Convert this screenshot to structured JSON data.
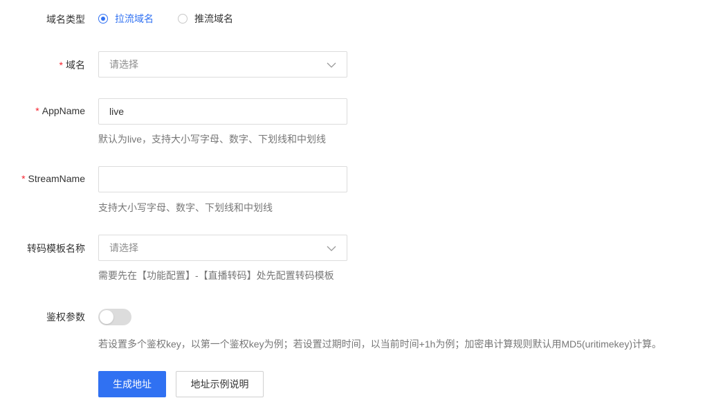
{
  "form": {
    "domain_type": {
      "label": "域名类型",
      "options": [
        {
          "label": "拉流域名",
          "checked": true
        },
        {
          "label": "推流域名",
          "checked": false
        }
      ]
    },
    "domain": {
      "required_mark": "*",
      "label": "域名",
      "placeholder": "请选择"
    },
    "app_name": {
      "required_mark": "*",
      "label": "AppName",
      "value": "live",
      "help": "默认为live，支持大小写字母、数字、下划线和中划线"
    },
    "stream_name": {
      "required_mark": "*",
      "label": "StreamName",
      "value": "",
      "help": "支持大小写字母、数字、下划线和中划线"
    },
    "transcode_template": {
      "label": "转码模板名称",
      "placeholder": "请选择",
      "help": "需要先在【功能配置】-【直播转码】处先配置转码模板"
    },
    "auth_params": {
      "label": "鉴权参数",
      "enabled": false,
      "help": "若设置多个鉴权key，以第一个鉴权key为例；若设置过期时间，以当前时间+1h为例；加密串计算规则默认用MD5(uritimekey)计算。"
    },
    "buttons": {
      "generate": "生成地址",
      "example": "地址示例说明"
    }
  },
  "colors": {
    "primary": "#3071f2",
    "required": "#f5222d",
    "help_text": "#777777",
    "border": "#dcdcdc"
  },
  "icons": {
    "select_arrow": "chevron-down-icon"
  }
}
